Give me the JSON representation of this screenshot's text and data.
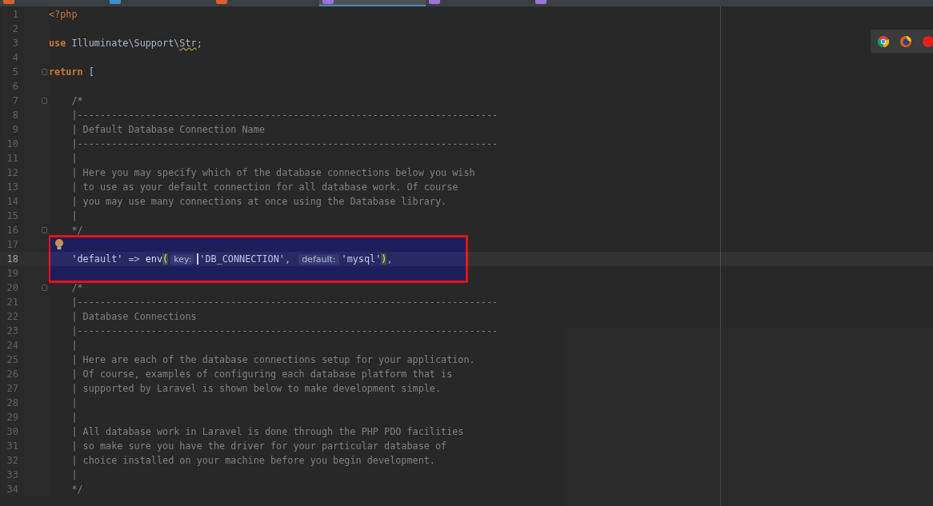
{
  "tabs": [
    {
      "kind": "php",
      "selected": false
    },
    {
      "kind": "web",
      "selected": false
    },
    {
      "kind": "php",
      "selected": false
    },
    {
      "kind": "config",
      "selected": true
    },
    {
      "kind": "config",
      "selected": false
    },
    {
      "kind": "config",
      "selected": false
    }
  ],
  "lines": [
    {
      "number": "1",
      "current": false,
      "fold": false,
      "tokens": [
        {
          "kind": "tag",
          "text": "<?php"
        }
      ]
    },
    {
      "number": "2",
      "current": false,
      "fold": false
    },
    {
      "number": "3",
      "current": false,
      "fold": false,
      "tokens": [
        {
          "kind": "keyword",
          "text": "use"
        },
        {
          "kind": "plain",
          "text": " Illuminate\\Support\\"
        },
        {
          "kind": "warn",
          "text": "Str"
        },
        {
          "kind": "plain",
          "text": ";"
        }
      ]
    },
    {
      "number": "4",
      "current": false,
      "fold": false
    },
    {
      "number": "5",
      "current": false,
      "fold": true,
      "tokens": [
        {
          "kind": "keyword",
          "text": "return"
        },
        {
          "kind": "plain",
          "text": " ["
        }
      ]
    },
    {
      "number": "6",
      "current": false,
      "fold": false
    },
    {
      "number": "7",
      "current": false,
      "fold": true,
      "tokens": [
        {
          "kind": "comment",
          "text": "    /*"
        }
      ]
    },
    {
      "number": "8",
      "current": false,
      "fold": false,
      "tokens": [
        {
          "kind": "comment",
          "text": "    |--------------------------------------------------------------------------"
        }
      ]
    },
    {
      "number": "9",
      "current": false,
      "fold": false,
      "tokens": [
        {
          "kind": "comment",
          "text": "    | Default Database Connection Name"
        }
      ]
    },
    {
      "number": "10",
      "current": false,
      "fold": false,
      "tokens": [
        {
          "kind": "comment",
          "text": "    |--------------------------------------------------------------------------"
        }
      ]
    },
    {
      "number": "11",
      "current": false,
      "fold": false,
      "tokens": [
        {
          "kind": "comment",
          "text": "    |"
        }
      ]
    },
    {
      "number": "12",
      "current": false,
      "fold": false,
      "tokens": [
        {
          "kind": "comment",
          "text": "    | Here you may specify which of the database connections below you wish"
        }
      ]
    },
    {
      "number": "13",
      "current": false,
      "fold": false,
      "tokens": [
        {
          "kind": "comment",
          "text": "    | to use as your default connection for all database work. Of course"
        }
      ]
    },
    {
      "number": "14",
      "current": false,
      "fold": false,
      "tokens": [
        {
          "kind": "comment",
          "text": "    | you may use many connections at once using the Database library."
        }
      ]
    },
    {
      "number": "15",
      "current": false,
      "fold": false,
      "tokens": [
        {
          "kind": "comment",
          "text": "    |"
        }
      ]
    },
    {
      "number": "16",
      "current": false,
      "fold": true,
      "tokens": [
        {
          "kind": "comment",
          "text": "    */"
        }
      ]
    },
    {
      "number": "17",
      "current": false,
      "fold": false,
      "tokens": [
        {
          "kind": "bulb"
        }
      ]
    },
    {
      "number": "18",
      "current": true,
      "fold": false,
      "tokens": [
        {
          "kind": "string",
          "text": "    'default'"
        },
        {
          "kind": "plain",
          "text": " => "
        },
        {
          "kind": "function",
          "text": "env"
        },
        {
          "kind": "paren",
          "text": "("
        },
        {
          "kind": "hint",
          "text": "key:"
        },
        {
          "kind": "caret"
        },
        {
          "kind": "string",
          "text": "'DB_CONNECTION'"
        },
        {
          "kind": "plain",
          "text": ", "
        },
        {
          "kind": "hint",
          "text": "default:"
        },
        {
          "kind": "string",
          "text": "'mysql'"
        },
        {
          "kind": "paren",
          "text": ")"
        },
        {
          "kind": "plain",
          "text": ","
        }
      ]
    },
    {
      "number": "19",
      "current": false,
      "fold": false
    },
    {
      "number": "20",
      "current": false,
      "fold": true,
      "tokens": [
        {
          "kind": "comment",
          "text": "    /*"
        }
      ]
    },
    {
      "number": "21",
      "current": false,
      "fold": false,
      "tokens": [
        {
          "kind": "comment",
          "text": "    |--------------------------------------------------------------------------"
        }
      ]
    },
    {
      "number": "22",
      "current": false,
      "fold": false,
      "tokens": [
        {
          "kind": "comment",
          "text": "    | Database Connections"
        }
      ]
    },
    {
      "number": "23",
      "current": false,
      "fold": false,
      "tokens": [
        {
          "kind": "comment",
          "text": "    |--------------------------------------------------------------------------"
        }
      ]
    },
    {
      "number": "24",
      "current": false,
      "fold": false,
      "tokens": [
        {
          "kind": "comment",
          "text": "    |"
        }
      ]
    },
    {
      "number": "25",
      "current": false,
      "fold": false,
      "tokens": [
        {
          "kind": "comment",
          "text": "    | Here are each of the database connections setup for your application."
        }
      ]
    },
    {
      "number": "26",
      "current": false,
      "fold": false,
      "tokens": [
        {
          "kind": "comment",
          "text": "    | Of course, examples of configuring each database platform that is"
        }
      ]
    },
    {
      "number": "27",
      "current": false,
      "fold": false,
      "tokens": [
        {
          "kind": "comment",
          "text": "    | supported by Laravel is shown below to make development simple."
        }
      ]
    },
    {
      "number": "28",
      "current": false,
      "fold": false,
      "tokens": [
        {
          "kind": "comment",
          "text": "    |"
        }
      ]
    },
    {
      "number": "29",
      "current": false,
      "fold": false,
      "tokens": [
        {
          "kind": "comment",
          "text": "    |"
        }
      ]
    },
    {
      "number": "30",
      "current": false,
      "fold": false,
      "tokens": [
        {
          "kind": "comment",
          "text": "    | All database work in Laravel is done through the PHP PDO facilities"
        }
      ]
    },
    {
      "number": "31",
      "current": false,
      "fold": false,
      "tokens": [
        {
          "kind": "comment",
          "text": "    | so make sure you have the driver for your particular database of"
        }
      ]
    },
    {
      "number": "32",
      "current": false,
      "fold": false,
      "tokens": [
        {
          "kind": "comment",
          "text": "    | choice installed on your machine before you begin development."
        }
      ]
    },
    {
      "number": "33",
      "current": false,
      "fold": false,
      "tokens": [
        {
          "kind": "comment",
          "text": "    |"
        }
      ]
    },
    {
      "number": "34",
      "current": false,
      "fold": false,
      "tokens": [
        {
          "kind": "comment",
          "text": "    */"
        }
      ]
    }
  ],
  "browsers": [
    {
      "kind": "chrome"
    },
    {
      "kind": "firefox"
    },
    {
      "kind": "red"
    }
  ]
}
